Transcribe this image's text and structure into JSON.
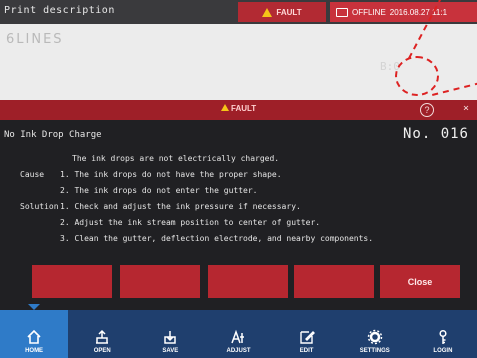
{
  "topbar": {
    "title": "Print description",
    "fault": "FAULT",
    "offline": "OFFLINE",
    "datetime": "2016.08.27 11:1"
  },
  "desc": {
    "text": "6LINES",
    "faint": "B:0"
  },
  "fault_header": {
    "label": "FAULT",
    "help": "?",
    "close": "×"
  },
  "message": {
    "title": "No Ink Drop Charge",
    "number": "No. 016",
    "statement": "The ink drops are not electrically charged.",
    "cause_label": "Cause",
    "causes": [
      "1. The ink drops do not have the proper shape.",
      "2. The ink drops do not enter the gutter."
    ],
    "solution_label": "Solution",
    "solutions": [
      "1. Check and adjust the ink pressure if necessary.",
      "2. Adjust the ink stream position to center of gutter.",
      "3. Clean the gutter, deflection electrode, and nearby components."
    ]
  },
  "buttons": {
    "close": "Close"
  },
  "nav": [
    {
      "label": "HOME",
      "icon": "home-icon"
    },
    {
      "label": "OPEN",
      "icon": "open-icon"
    },
    {
      "label": "SAVE",
      "icon": "save-icon"
    },
    {
      "label": "ADJUST",
      "icon": "adjust-icon"
    },
    {
      "label": "EDIT",
      "icon": "edit-icon"
    },
    {
      "label": "SETTINGS",
      "icon": "gear-icon"
    },
    {
      "label": "LOGIN",
      "icon": "key-icon"
    }
  ],
  "colors": {
    "fault_red": "#b22a33",
    "nav_blue": "#1f3f6e",
    "active_blue": "#2f7bc8"
  }
}
